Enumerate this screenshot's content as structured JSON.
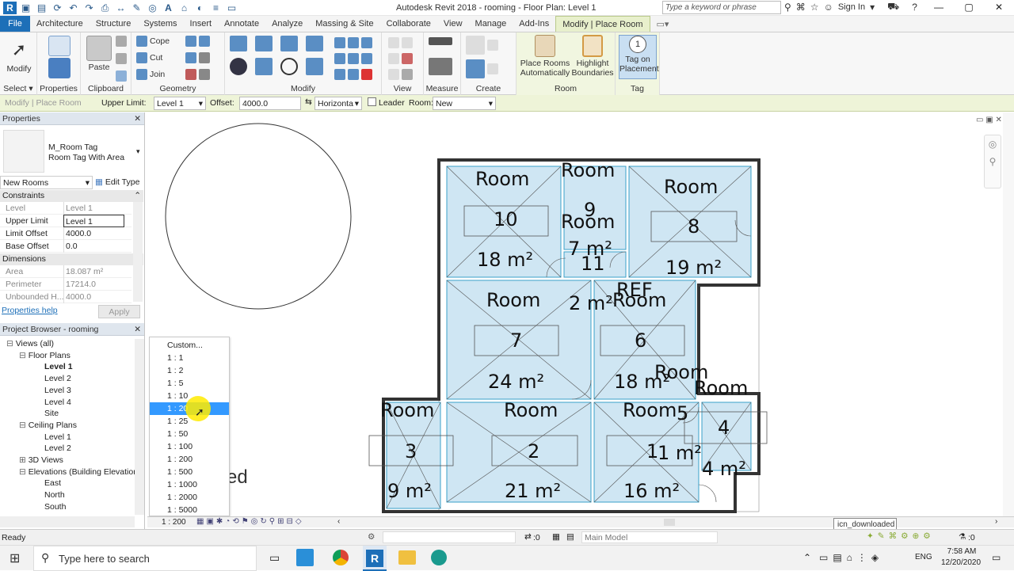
{
  "app": {
    "title": "Autodesk Revit 2018 -    rooming - Floor Plan: Level 1",
    "search_placeholder": "Type a keyword or phrase",
    "sign_in": "Sign In"
  },
  "tabs": [
    "File",
    "Architecture",
    "Structure",
    "Systems",
    "Insert",
    "Annotate",
    "Analyze",
    "Massing & Site",
    "Collaborate",
    "View",
    "Manage",
    "Add-Ins",
    "Modify | Place Room"
  ],
  "ribbon": {
    "modify": "Modify",
    "properties": "Properties",
    "paste": "Paste",
    "cope": "Cope",
    "cut": "Cut",
    "join": "Join",
    "select": "Select",
    "select_group": "Select",
    "properties_group": "Properties",
    "clipboard_group": "Clipboard",
    "geometry_group": "Geometry",
    "modify_group": "Modify",
    "view_group": "View",
    "measure_group": "Measure",
    "create_group": "Create",
    "place_rooms_1": "Place Rooms",
    "place_rooms_2": "Automatically",
    "highlight_1": "Highlight",
    "highlight_2": "Boundaries",
    "tag_1": "Tag on",
    "tag_2": "Placement",
    "room_group": "Room",
    "tag_group": "Tag"
  },
  "options_bar": {
    "context": "Modify | Place Room",
    "upper_limit_label": "Upper Limit:",
    "upper_limit_value": "Level 1",
    "offset_label": "Offset:",
    "offset_value": "4000.0",
    "orientation": "Horizonta",
    "leader_label": "Leader",
    "room_label": "Room:",
    "room_value": "New"
  },
  "properties": {
    "header": "Properties",
    "type_name_1": "M_Room Tag",
    "type_name_2": "Room Tag With Area",
    "selector": "New Rooms",
    "edit_type": "Edit Type",
    "constraints": "Constraints",
    "dimensions": "Dimensions",
    "rows": [
      {
        "k": "Level",
        "v": "Level 1"
      },
      {
        "k": "Upper Limit",
        "v": "Level 1"
      },
      {
        "k": "Limit Offset",
        "v": "4000.0"
      },
      {
        "k": "Base Offset",
        "v": "0.0"
      }
    ],
    "dim_rows": [
      {
        "k": "Area",
        "v": "18.087 m²"
      },
      {
        "k": "Perimeter",
        "v": "17214.0"
      },
      {
        "k": "Unbounded H...",
        "v": "4000.0"
      }
    ],
    "help": "Properties help",
    "apply": "Apply"
  },
  "browser": {
    "header": "Project Browser - rooming",
    "items": [
      {
        "label": "Views (all)",
        "level": 0,
        "bold": false
      },
      {
        "label": "Floor Plans",
        "level": 1,
        "bold": false
      },
      {
        "label": "Level 1",
        "level": 2,
        "bold": true
      },
      {
        "label": "Level 2",
        "level": 2,
        "bold": false
      },
      {
        "label": "Level 3",
        "level": 2,
        "bold": false
      },
      {
        "label": "Level 4",
        "level": 2,
        "bold": false
      },
      {
        "label": "Site",
        "level": 2,
        "bold": false
      },
      {
        "label": "Ceiling Plans",
        "level": 1,
        "bold": false
      },
      {
        "label": "Level 1",
        "level": 2,
        "bold": false
      },
      {
        "label": "Level 2",
        "level": 2,
        "bold": false
      },
      {
        "label": "3D Views",
        "level": 1,
        "bold": false
      },
      {
        "label": "Elevations (Building Elevation",
        "level": 1,
        "bold": false
      },
      {
        "label": "East",
        "level": 2,
        "bold": false
      },
      {
        "label": "North",
        "level": 2,
        "bold": false
      },
      {
        "label": "South",
        "level": 2,
        "bold": false
      }
    ]
  },
  "scale_menu": {
    "items": [
      "Custom...",
      "1 : 1",
      "1 : 2",
      "1 : 5",
      "1 : 10",
      "1 : 20",
      "1 : 25",
      "1 : 50",
      "1 : 100",
      "1 : 200",
      "1 : 500",
      "1 : 1000",
      "1 : 2000",
      "1 : 5000"
    ],
    "selected": "1 : 20"
  },
  "view_control": {
    "scale": "1 : 200"
  },
  "canvas_bg_text": "ed",
  "rooms": [
    {
      "label": "Room",
      "num": "10",
      "area": "18 m²"
    },
    {
      "label": "Room",
      "num": "9",
      "area": "7 m²"
    },
    {
      "label": "Room",
      "num": "8",
      "area": "19 m²"
    },
    {
      "label": "Room",
      "num": "11",
      "area": "2 m²"
    },
    {
      "label": "Room",
      "num": "7",
      "area": "24 m²"
    },
    {
      "label": "Room",
      "num": "6",
      "area": "18 m²"
    },
    {
      "label": "REF",
      "num": "",
      "area": ""
    },
    {
      "label": "Room",
      "num": "5",
      "area": "1 m²"
    },
    {
      "label": "Room",
      "num": "4",
      "area": "4 m²"
    },
    {
      "label": "Room",
      "num": "3",
      "area": "9 m²"
    },
    {
      "label": "Room",
      "num": "2",
      "area": "21 m²"
    },
    {
      "label": "Room",
      "num": "1",
      "area": "16 m²"
    }
  ],
  "status": {
    "text": "Ready",
    "zero": ":0",
    "model": "Main Model",
    "filter": ":0"
  },
  "tooltip": "icn_downloaded",
  "taskbar": {
    "search": "Type here to search",
    "lang": "ENG",
    "time": "7:58 AM",
    "date": "12/20/2020"
  }
}
